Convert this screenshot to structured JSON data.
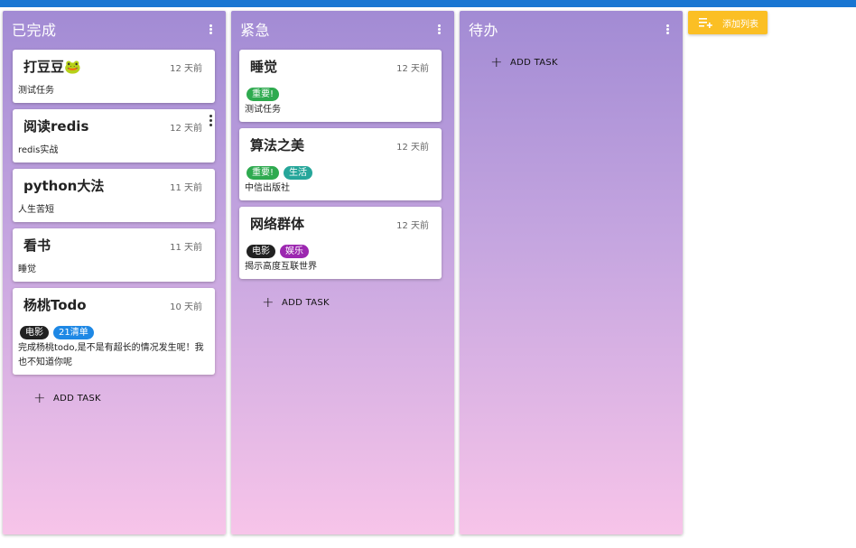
{
  "columns": [
    {
      "title": "已完成",
      "add_task_label": "ADD TASK",
      "cards": [
        {
          "title": "打豆豆🐸",
          "time": "12 天前",
          "desc": "测试任务",
          "tags": []
        },
        {
          "title": "阅读redis",
          "time": "12 天前",
          "desc": "redis实战",
          "tags": []
        },
        {
          "title": "python大法",
          "time": "11 天前",
          "desc": "人生苦短",
          "tags": []
        },
        {
          "title": "看书",
          "time": "11 天前",
          "desc": "睡觉",
          "tags": []
        },
        {
          "title": "杨桃Todo",
          "time": "10 天前",
          "desc": "完成杨桃todo,是不是有超长的情况发生呢！我也不知道你呢",
          "tags": [
            {
              "label": "电影",
              "color": "#212121"
            },
            {
              "label": "21清单",
              "color": "#1e88e5"
            }
          ]
        }
      ]
    },
    {
      "title": "紧急",
      "add_task_label": "ADD TASK",
      "cards": [
        {
          "title": "睡觉",
          "time": "12 天前",
          "desc": "测试任务",
          "tags": [
            {
              "label": "重要!",
              "color": "#2eaa4f"
            }
          ]
        },
        {
          "title": "算法之美",
          "time": "12 天前",
          "desc": "中信出版社",
          "tags": [
            {
              "label": "重要!",
              "color": "#2eaa4f"
            },
            {
              "label": "生活",
              "color": "#26a69a"
            }
          ]
        },
        {
          "title": "网络群体",
          "time": "12 天前",
          "desc": "揭示高度互联世界",
          "tags": [
            {
              "label": "电影",
              "color": "#212121"
            },
            {
              "label": "娱乐",
              "color": "#9c27b0"
            }
          ]
        }
      ]
    },
    {
      "title": "待办",
      "add_task_label": "ADD TASK",
      "cards": []
    }
  ],
  "add_list": {
    "label": "添加列表",
    "icon": "playlist-add-icon"
  },
  "colors": {
    "accent_bar": "#1976d2",
    "add_list_button": "#fbbf24"
  }
}
